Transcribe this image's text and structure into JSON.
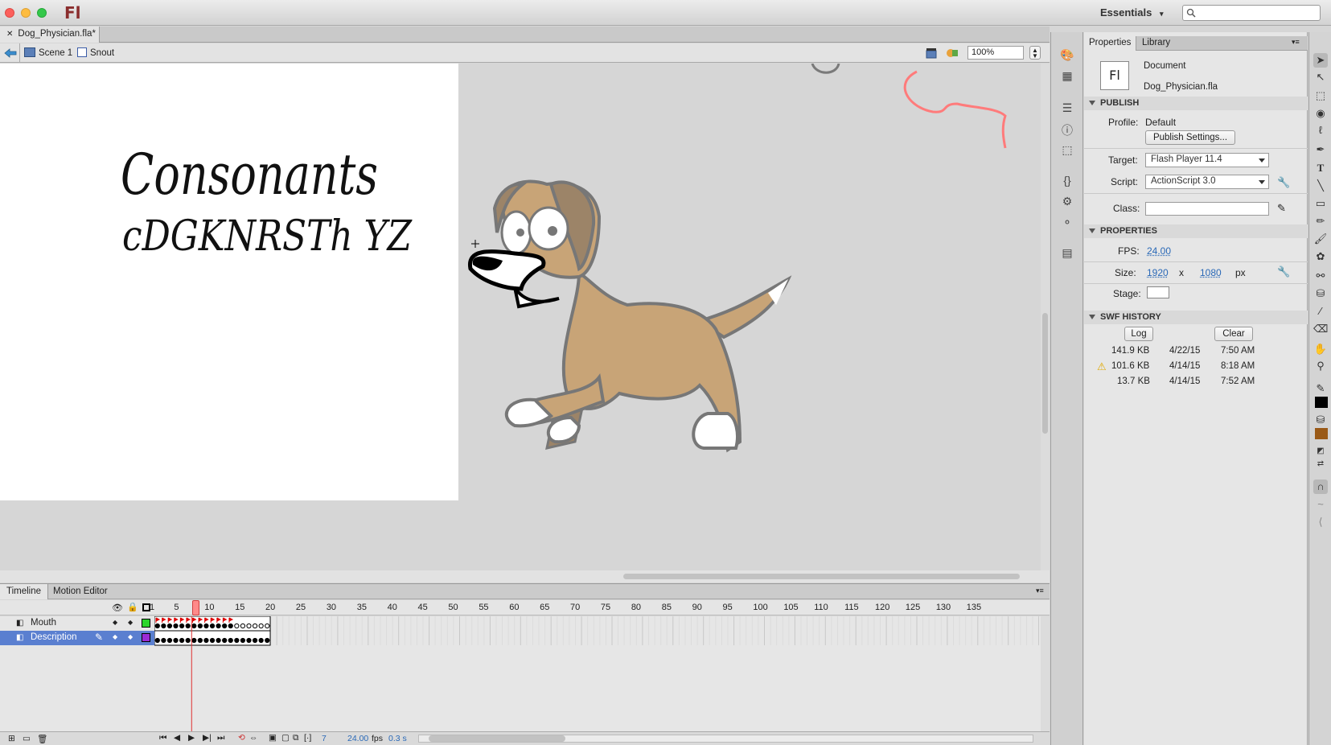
{
  "app": {
    "logo": "Fl",
    "workspace": "Essentials"
  },
  "document": {
    "tab": "Dog_Physician.fla*"
  },
  "editbar": {
    "scene": "Scene 1",
    "symbol": "Snout",
    "zoom": "100%"
  },
  "stage": {
    "handwriting_line1": "Consonants",
    "handwriting_line2": "cDGKNRSTh YZ"
  },
  "timeline": {
    "tabs": [
      "Timeline",
      "Motion Editor"
    ],
    "ruler": [
      "1",
      "5",
      "10",
      "15",
      "20",
      "25",
      "30",
      "35",
      "40",
      "45",
      "50",
      "55",
      "60",
      "65",
      "70",
      "75",
      "80",
      "85",
      "90",
      "95",
      "100",
      "105",
      "110",
      "115",
      "120",
      "125",
      "130",
      "135"
    ],
    "layers": [
      {
        "name": "Mouth",
        "color": "#2bd52b"
      },
      {
        "name": "Description",
        "color": "#9b2bd5"
      }
    ],
    "status": {
      "frame": "7",
      "fps": "24.00",
      "fps_unit": "fps",
      "time": "0.3 s"
    }
  },
  "properties": {
    "tabs": [
      "Properties",
      "Library"
    ],
    "doc_type": "Document",
    "doc_name": "Dog_Physician.fla",
    "publish": {
      "header": "PUBLISH",
      "profile_label": "Profile:",
      "profile": "Default",
      "settings_button": "Publish Settings...",
      "target_label": "Target:",
      "target": "Flash Player 11.4",
      "script_label": "Script:",
      "script": "ActionScript 3.0",
      "class_label": "Class:"
    },
    "props": {
      "header": "PROPERTIES",
      "fps_label": "FPS:",
      "fps": "24.00",
      "size_label": "Size:",
      "width": "1920",
      "x": "x",
      "height": "1080",
      "unit": "px",
      "stage_label": "Stage:",
      "stage_color": "#ffffff"
    },
    "history": {
      "header": "SWF HISTORY",
      "log_button": "Log",
      "clear_button": "Clear",
      "rows": [
        {
          "size": "141.9 KB",
          "date": "4/22/15",
          "time": "7:50 AM",
          "warning": false
        },
        {
          "size": "101.6 KB",
          "date": "4/14/15",
          "time": "8:18 AM",
          "warning": true
        },
        {
          "size": "13.7 KB",
          "date": "4/14/15",
          "time": "7:52 AM",
          "warning": false
        }
      ]
    }
  },
  "colors": {
    "stroke_color": "#000000",
    "fill_color": "#9a5a17"
  }
}
